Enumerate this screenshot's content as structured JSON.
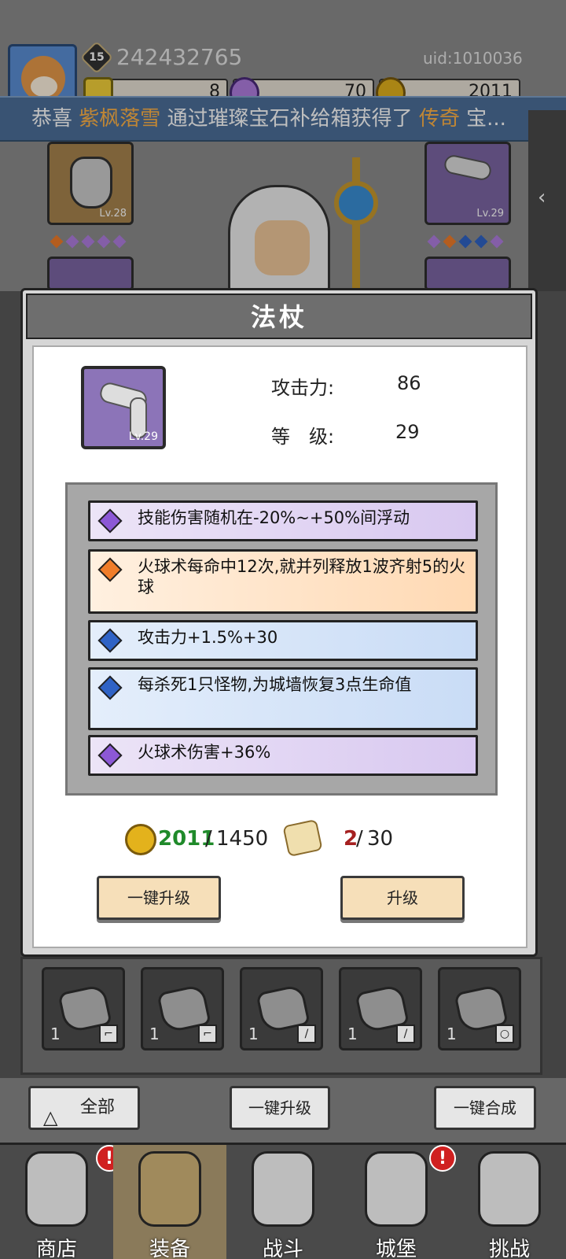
{
  "header": {
    "player_level": "15",
    "player_name": "242432765",
    "uid": "uid:1010036",
    "currencies": {
      "gem": "8",
      "crystal": "70",
      "gold": "2011"
    }
  },
  "marquee": {
    "prefix": "恭喜",
    "player": "紫枫落雪",
    "middle": "通过璀璨宝石补给箱获得了",
    "item": "传奇",
    "suffix": "宝..."
  },
  "side_tab": {
    "icon": "chevron-left-icon",
    "glyph": "‹"
  },
  "equip_slots": {
    "helm_level": "Lv.28",
    "weapon_level": "Lv.29"
  },
  "colors": {
    "purple": "#8c74b8",
    "orange": "#f07d2a",
    "blue": "#2f63c6",
    "gold_have": "#1f8a2a",
    "scroll_have": "#a52020"
  },
  "modal": {
    "title": "法杖",
    "item_level": "Lv.29",
    "attack_label": "攻击力:",
    "attack_value": "86",
    "level_label": "等　级:",
    "level_value": "29",
    "affixes": [
      {
        "color": "purple",
        "text": "技能伤害随机在-20%~+50%间浮动"
      },
      {
        "color": "orange",
        "text": "火球术每命中12次,就并列释放1波齐射5的火球"
      },
      {
        "color": "blue",
        "text": "攻击力+1.5%+30"
      },
      {
        "color": "blue",
        "text": "每杀死1只怪物,为城墙恢复3点生命值"
      },
      {
        "color": "purple",
        "text": "火球术伤害+36%"
      }
    ],
    "cost": {
      "gold_have": "2011",
      "gold_need": "1450",
      "scroll_have": "2",
      "scroll_need": "30",
      "separator": "/"
    },
    "buttons": {
      "upgrade_all": "一键升级",
      "upgrade": "升级"
    }
  },
  "inventory": [
    {
      "count": "1",
      "tag": "boot-icon"
    },
    {
      "count": "1",
      "tag": "boot-icon"
    },
    {
      "count": "1",
      "tag": "staff-icon"
    },
    {
      "count": "1",
      "tag": "staff-icon"
    },
    {
      "count": "1",
      "tag": "ring-icon"
    }
  ],
  "actions": {
    "all": "全部",
    "bulk_upgrade": "一键升级",
    "bulk_merge": "一键合成"
  },
  "nav": {
    "shop": "商店",
    "equip": "装备",
    "battle": "战斗",
    "castle": "城堡",
    "challenge": "挑战",
    "badge": "!"
  }
}
